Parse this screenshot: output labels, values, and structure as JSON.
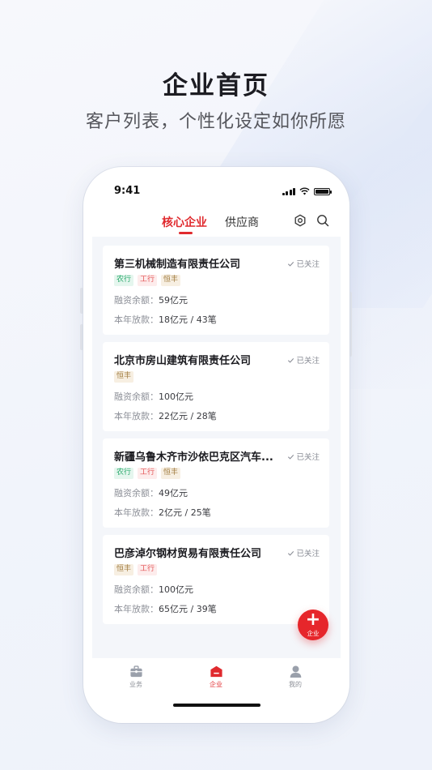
{
  "hero": {
    "title": "企业首页",
    "subtitle": "客户列表，个性化设定如你所愿"
  },
  "status_bar": {
    "time": "9:41"
  },
  "tabs": [
    {
      "label": "核心企业",
      "active": true
    },
    {
      "label": "供应商",
      "active": false
    }
  ],
  "header_icons": [
    "settings-icon",
    "search-icon"
  ],
  "labels": {
    "balance": "融资余额：",
    "loans": "本年放款："
  },
  "companies": [
    {
      "name": "第三机械制造有限责任公司",
      "status": "已关注",
      "tags": [
        "农行",
        "工行",
        "恒丰"
      ],
      "balance": "59亿元",
      "loans": "18亿元 / 43笔"
    },
    {
      "name": "北京市房山建筑有限责任公司",
      "status": "已关注",
      "tags": [
        "恒丰"
      ],
      "balance": "100亿元",
      "loans": "22亿元 / 28笔"
    },
    {
      "name": "新疆乌鲁木齐市沙依巴克区汽车...",
      "status": "已关注",
      "tags": [
        "农行",
        "工行",
        "恒丰"
      ],
      "balance": "49亿元",
      "loans": "2亿元 / 25笔"
    },
    {
      "name": "巴彦淖尔钢材贸易有限责任公司",
      "status": "已关注",
      "tags": [
        "恒丰",
        "工行"
      ],
      "balance": "100亿元",
      "loans": "65亿元 / 39笔"
    }
  ],
  "fab": {
    "icon": "plus-icon",
    "label": "企业"
  },
  "bottom_nav": [
    {
      "label": "业务",
      "icon": "briefcase-icon",
      "active": false
    },
    {
      "label": "企业",
      "icon": "building-icon",
      "active": true
    },
    {
      "label": "我的",
      "icon": "user-icon",
      "active": false
    }
  ],
  "colors": {
    "accent": "#e02a2e",
    "tag_green": "#27a86a",
    "tag_red": "#e35355",
    "tag_brown": "#a07b3f"
  }
}
